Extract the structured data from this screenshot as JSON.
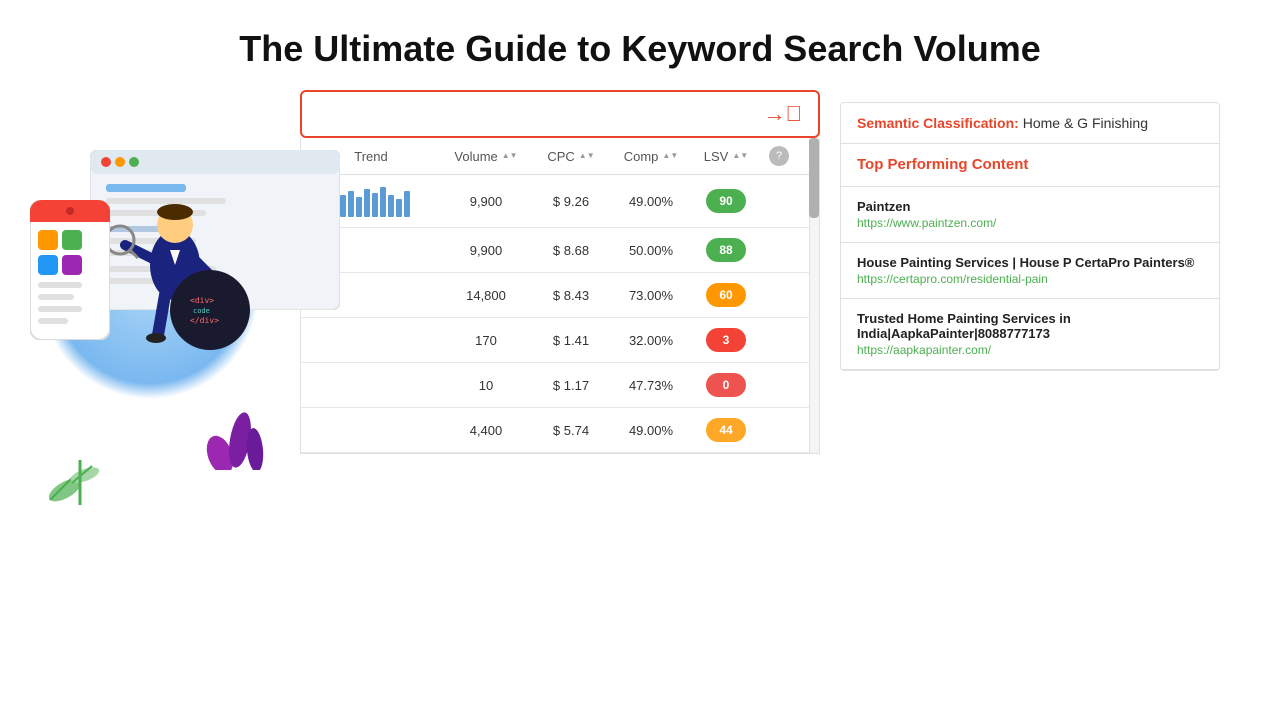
{
  "title": "The Ultimate Guide to Keyword Search Volume",
  "search_bar": {
    "placeholder": ""
  },
  "table": {
    "headers": [
      "Trend",
      "Volume",
      "CPC",
      "Comp",
      "LSV",
      ""
    ],
    "rows": [
      {
        "trend_heights": [
          18,
          22,
          26,
          20,
          28,
          24,
          30,
          22,
          18,
          26
        ],
        "volume": "9,900",
        "cpc": "$ 9.26",
        "comp": "49.00%",
        "lsv": "90",
        "lsv_class": "lsv-green"
      },
      {
        "trend_heights": null,
        "volume": "9,900",
        "cpc": "$ 8.68",
        "comp": "50.00%",
        "lsv": "88",
        "lsv_class": "lsv-green"
      },
      {
        "trend_heights": null,
        "volume": "14,800",
        "cpc": "$ 8.43",
        "comp": "73.00%",
        "lsv": "60",
        "lsv_class": "lsv-orange"
      },
      {
        "trend_heights": null,
        "volume": "170",
        "cpc": "$ 1.41",
        "comp": "32.00%",
        "lsv": "3",
        "lsv_class": "lsv-red"
      },
      {
        "trend_heights": null,
        "volume": "10",
        "cpc": "$ 1.17",
        "comp": "47.73%",
        "lsv": "0",
        "lsv_class": "lsv-red2"
      },
      {
        "trend_heights": null,
        "volume": "4,400",
        "cpc": "$ 5.74",
        "comp": "49.00%",
        "lsv": "44",
        "lsv_class": "lsv-orange2"
      }
    ]
  },
  "right_panel": {
    "semantic_label": "Semantic Classification:",
    "semantic_value": "Home & G Finishing",
    "top_performing_title": "Top Performing Content",
    "items": [
      {
        "title": "Paintzen",
        "url": "https://www.paintzen.com/"
      },
      {
        "title": "House Painting Services | House P CertaPro Painters®",
        "url": "https://certapro.com/residential-pain"
      },
      {
        "title": "Trusted Home Painting Services in India|AapkaPainter|8088777173",
        "url": "https://aapkapainter.com/"
      }
    ]
  },
  "lsv_badge_colors": {
    "green": "#4caf50",
    "orange": "#ff9800",
    "red": "#f44336"
  }
}
